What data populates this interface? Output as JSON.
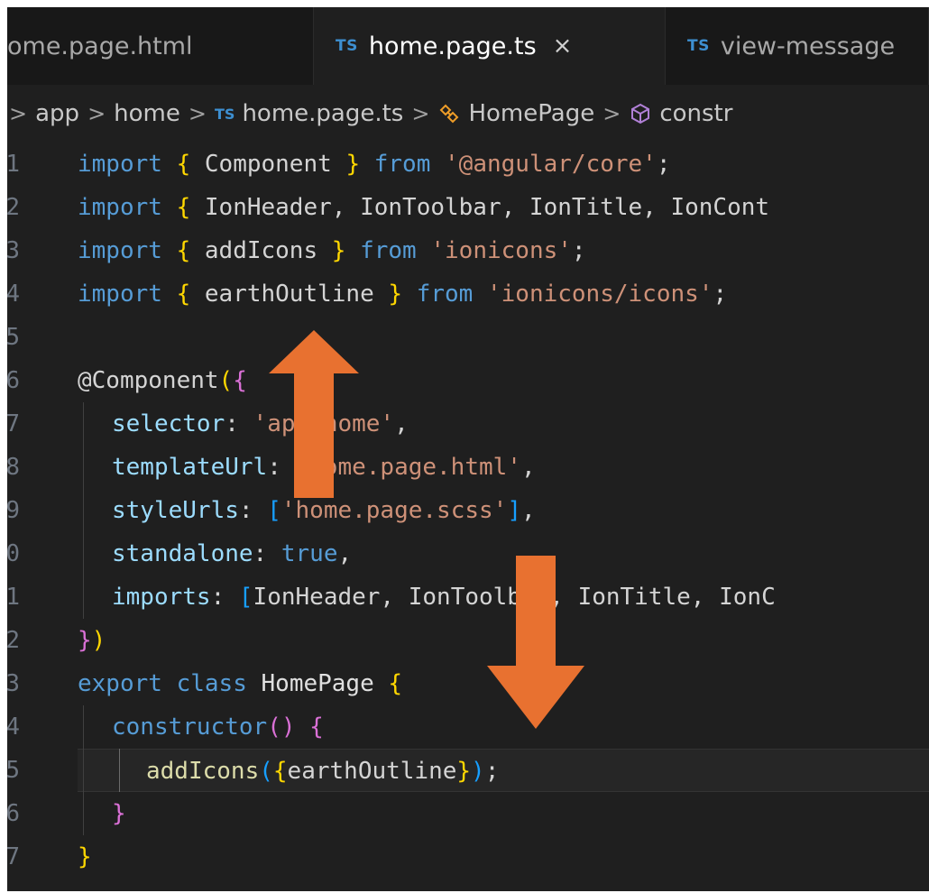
{
  "tabs": [
    {
      "label": "ome.page.html",
      "badge": "",
      "active": false
    },
    {
      "label": "home.page.ts",
      "badge": "TS",
      "active": true,
      "close": "×"
    },
    {
      "label": "view-message",
      "badge": "TS",
      "active": false
    }
  ],
  "breadcrumb": {
    "items": [
      "app",
      "home",
      "home.page.ts",
      "HomePage",
      "constr"
    ],
    "file_badge": "TS",
    "separator": ">"
  },
  "code": {
    "line_numbers": [
      "1",
      "2",
      "3",
      "4",
      "5",
      "6",
      "7",
      "8",
      "9",
      "0",
      "1",
      "2",
      "3",
      "4",
      "5",
      "6",
      "7"
    ],
    "l1": {
      "kw": "import",
      "ob": "{",
      "id": "Component",
      "cb": "}",
      "from": "from",
      "str": "'@angular/core'",
      "semi": ";"
    },
    "l2": {
      "kw": "import",
      "ob": "{",
      "id": "IonHeader, IonToolbar, IonTitle, IonCont"
    },
    "l3": {
      "kw": "import",
      "ob": "{",
      "id": "addIcons",
      "cb": "}",
      "from": "from",
      "str": "'ionicons'",
      "semi": ";"
    },
    "l4": {
      "kw": "import",
      "ob": "{",
      "id": "earthOutline",
      "cb": "}",
      "from": "from",
      "str": "'ionicons/icons'",
      "semi": ";"
    },
    "l6": {
      "at": "@Component",
      "op": "(",
      "ob": "{"
    },
    "l7": {
      "prop": "selector",
      "colon": ": ",
      "str": "'app-home'",
      "comma": ","
    },
    "l8": {
      "prop": "templateUrl",
      "colon": ": ",
      "str": "'home.page.html'",
      "comma": ","
    },
    "l9": {
      "prop": "styleUrls",
      "colon": ": ",
      "ob": "[",
      "str": "'home.page.scss'",
      "cb": "]",
      "comma": ","
    },
    "l10": {
      "prop": "standalone",
      "colon": ": ",
      "val": "true",
      "comma": ","
    },
    "l11": {
      "prop": "imports",
      "colon": ": ",
      "ob": "[",
      "id": "IonHeader, IonToolbar, IonTitle, IonC"
    },
    "l12": {
      "cb": "}",
      "cp": ")"
    },
    "l13": {
      "kw1": "export",
      "kw2": "class",
      "cls": "HomePage",
      "ob": "{"
    },
    "l14": {
      "fn": "constructor",
      "parens": "()",
      "ob": "{"
    },
    "l15": {
      "fn": "addIcons",
      "op": "(",
      "ob": "{",
      "id": "earthOutline",
      "cb": "}",
      "cp": ")",
      "semi": ";"
    },
    "l16": {
      "cb": "}"
    },
    "l17": {
      "cb": "}"
    }
  },
  "colors": {
    "editor_bg": "#1f1f1f",
    "keyword": "#569cd6",
    "string": "#ce9178",
    "bracket_gold": "#ffd700",
    "arrow": "#e87130"
  },
  "icons": [
    "class-symbol-icon",
    "method-cube-icon",
    "close-icon",
    "arrow-up-icon",
    "arrow-down-icon"
  ]
}
